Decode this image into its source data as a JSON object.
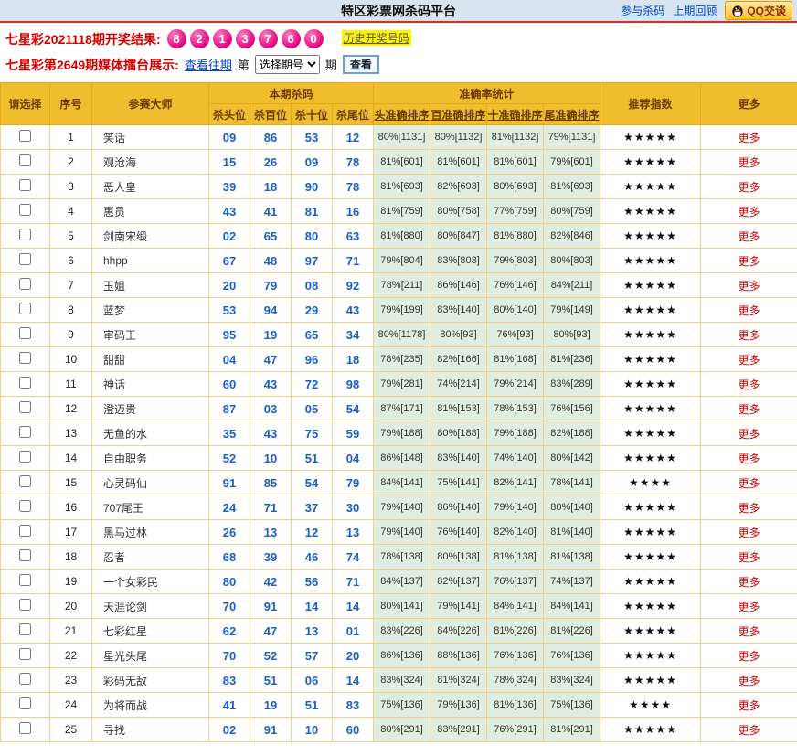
{
  "header": {
    "title": "特区彩票网杀码平台",
    "links": {
      "join": "参与杀码",
      "last_review": "上期回顾",
      "qq": "QQ交谈"
    }
  },
  "result_bar": {
    "label": "七星彩2021118期开奖结果:",
    "balls": [
      "8",
      "2",
      "1",
      "3",
      "7",
      "6",
      "0"
    ],
    "history_link": "历史开奖号码"
  },
  "filter_bar": {
    "label": "七星彩第2649期媒体擂台展示:",
    "view_past": "查看往期",
    "di": "第",
    "select_value": "选择期号",
    "qi": "期",
    "search_button": "查看"
  },
  "table": {
    "headers": {
      "select": "请选择",
      "index": "序号",
      "master": "参赛大师",
      "kill_group": "本期杀码",
      "kill_cols": [
        "杀头位",
        "杀百位",
        "杀十位",
        "杀尾位"
      ],
      "accuracy_group": "准确率统计",
      "accuracy_cols": [
        "头准确排序",
        "百准确排序",
        "十准确排序",
        "尾准确排序"
      ],
      "rating": "推荐指数",
      "more": "更多"
    },
    "more_label": "更多",
    "rows": [
      {
        "index": "1",
        "master": "笑话",
        "kills": [
          "09",
          "86",
          "53",
          "12"
        ],
        "accuracy": [
          "80%[1131]",
          "80%[1132]",
          "81%[1132]",
          "79%[1131]"
        ],
        "stars": 5
      },
      {
        "index": "2",
        "master": "观沧海",
        "kills": [
          "15",
          "26",
          "09",
          "78"
        ],
        "accuracy": [
          "81%[601]",
          "81%[601]",
          "81%[601]",
          "79%[601]"
        ],
        "stars": 5
      },
      {
        "index": "3",
        "master": "恶人皇",
        "kills": [
          "39",
          "18",
          "90",
          "78"
        ],
        "accuracy": [
          "81%[693]",
          "82%[693]",
          "80%[693]",
          "81%[693]"
        ],
        "stars": 5
      },
      {
        "index": "4",
        "master": "惠员",
        "kills": [
          "43",
          "41",
          "81",
          "16"
        ],
        "accuracy": [
          "81%[759]",
          "80%[758]",
          "77%[759]",
          "80%[759]"
        ],
        "stars": 5
      },
      {
        "index": "5",
        "master": "剑南宋缎",
        "kills": [
          "02",
          "65",
          "80",
          "63"
        ],
        "accuracy": [
          "81%[880]",
          "80%[847]",
          "81%[880]",
          "82%[846]"
        ],
        "stars": 5
      },
      {
        "index": "6",
        "master": "hhpp",
        "kills": [
          "67",
          "48",
          "97",
          "71"
        ],
        "accuracy": [
          "79%[804]",
          "83%[803]",
          "79%[803]",
          "80%[803]"
        ],
        "stars": 5
      },
      {
        "index": "7",
        "master": "玉姐",
        "kills": [
          "20",
          "79",
          "08",
          "92"
        ],
        "accuracy": [
          "78%[211]",
          "86%[146]",
          "76%[146]",
          "84%[211]"
        ],
        "stars": 5
      },
      {
        "index": "8",
        "master": "蓝梦",
        "kills": [
          "53",
          "94",
          "29",
          "43"
        ],
        "accuracy": [
          "79%[199]",
          "83%[140]",
          "80%[140]",
          "79%[149]"
        ],
        "stars": 5
      },
      {
        "index": "9",
        "master": "审码王",
        "kills": [
          "95",
          "19",
          "65",
          "34"
        ],
        "accuracy": [
          "80%[1178]",
          "80%[93]",
          "76%[93]",
          "80%[93]"
        ],
        "stars": 5
      },
      {
        "index": "10",
        "master": "甜甜",
        "kills": [
          "04",
          "47",
          "96",
          "18"
        ],
        "accuracy": [
          "78%[235]",
          "82%[166]",
          "81%[168]",
          "81%[236]"
        ],
        "stars": 5
      },
      {
        "index": "11",
        "master": "神话",
        "kills": [
          "60",
          "43",
          "72",
          "98"
        ],
        "accuracy": [
          "79%[281]",
          "74%[214]",
          "79%[214]",
          "83%[289]"
        ],
        "stars": 5
      },
      {
        "index": "12",
        "master": "澄迈贵",
        "kills": [
          "87",
          "03",
          "05",
          "54"
        ],
        "accuracy": [
          "87%[171]",
          "81%[153]",
          "78%[153]",
          "76%[156]"
        ],
        "stars": 5
      },
      {
        "index": "13",
        "master": "无鱼的水",
        "kills": [
          "35",
          "43",
          "75",
          "59"
        ],
        "accuracy": [
          "79%[188]",
          "80%[188]",
          "79%[188]",
          "82%[188]"
        ],
        "stars": 5
      },
      {
        "index": "14",
        "master": "自由职务",
        "kills": [
          "52",
          "10",
          "51",
          "04"
        ],
        "accuracy": [
          "86%[148]",
          "83%[140]",
          "74%[140]",
          "80%[142]"
        ],
        "stars": 5
      },
      {
        "index": "15",
        "master": "心灵码仙",
        "kills": [
          "91",
          "85",
          "54",
          "79"
        ],
        "accuracy": [
          "84%[141]",
          "75%[141]",
          "82%[141]",
          "78%[141]"
        ],
        "stars": 4
      },
      {
        "index": "16",
        "master": "707尾王",
        "kills": [
          "24",
          "71",
          "37",
          "30"
        ],
        "accuracy": [
          "79%[140]",
          "86%[140]",
          "79%[140]",
          "80%[140]"
        ],
        "stars": 5
      },
      {
        "index": "17",
        "master": "黑马过林",
        "kills": [
          "26",
          "13",
          "12",
          "13"
        ],
        "accuracy": [
          "79%[140]",
          "76%[140]",
          "82%[140]",
          "81%[140]"
        ],
        "stars": 5
      },
      {
        "index": "18",
        "master": "忍者",
        "kills": [
          "68",
          "39",
          "46",
          "74"
        ],
        "accuracy": [
          "78%[138]",
          "80%[138]",
          "81%[138]",
          "81%[138]"
        ],
        "stars": 5
      },
      {
        "index": "19",
        "master": "一个女彩民",
        "kills": [
          "80",
          "42",
          "56",
          "71"
        ],
        "accuracy": [
          "84%[137]",
          "82%[137]",
          "76%[137]",
          "74%[137]"
        ],
        "stars": 5
      },
      {
        "index": "20",
        "master": "天涯论剑",
        "kills": [
          "70",
          "91",
          "14",
          "14"
        ],
        "accuracy": [
          "80%[141]",
          "79%[141]",
          "84%[141]",
          "84%[141]"
        ],
        "stars": 5
      },
      {
        "index": "21",
        "master": "七彩红星",
        "kills": [
          "62",
          "47",
          "13",
          "01"
        ],
        "accuracy": [
          "83%[226]",
          "84%[226]",
          "81%[226]",
          "81%[226]"
        ],
        "stars": 5
      },
      {
        "index": "22",
        "master": "星光头尾",
        "kills": [
          "70",
          "52",
          "57",
          "20"
        ],
        "accuracy": [
          "86%[136]",
          "88%[136]",
          "76%[136]",
          "76%[136]"
        ],
        "stars": 5
      },
      {
        "index": "23",
        "master": "彩码无敌",
        "kills": [
          "83",
          "51",
          "06",
          "14"
        ],
        "accuracy": [
          "83%[324]",
          "81%[324]",
          "78%[324]",
          "83%[324]"
        ],
        "stars": 5
      },
      {
        "index": "24",
        "master": "为将而战",
        "kills": [
          "41",
          "19",
          "51",
          "83"
        ],
        "accuracy": [
          "75%[136]",
          "79%[136]",
          "81%[136]",
          "75%[136]"
        ],
        "stars": 4
      },
      {
        "index": "25",
        "master": "寻找",
        "kills": [
          "02",
          "91",
          "10",
          "60"
        ],
        "accuracy": [
          "80%[291]",
          "83%[291]",
          "76%[291]",
          "81%[291]"
        ],
        "stars": 5
      }
    ]
  }
}
